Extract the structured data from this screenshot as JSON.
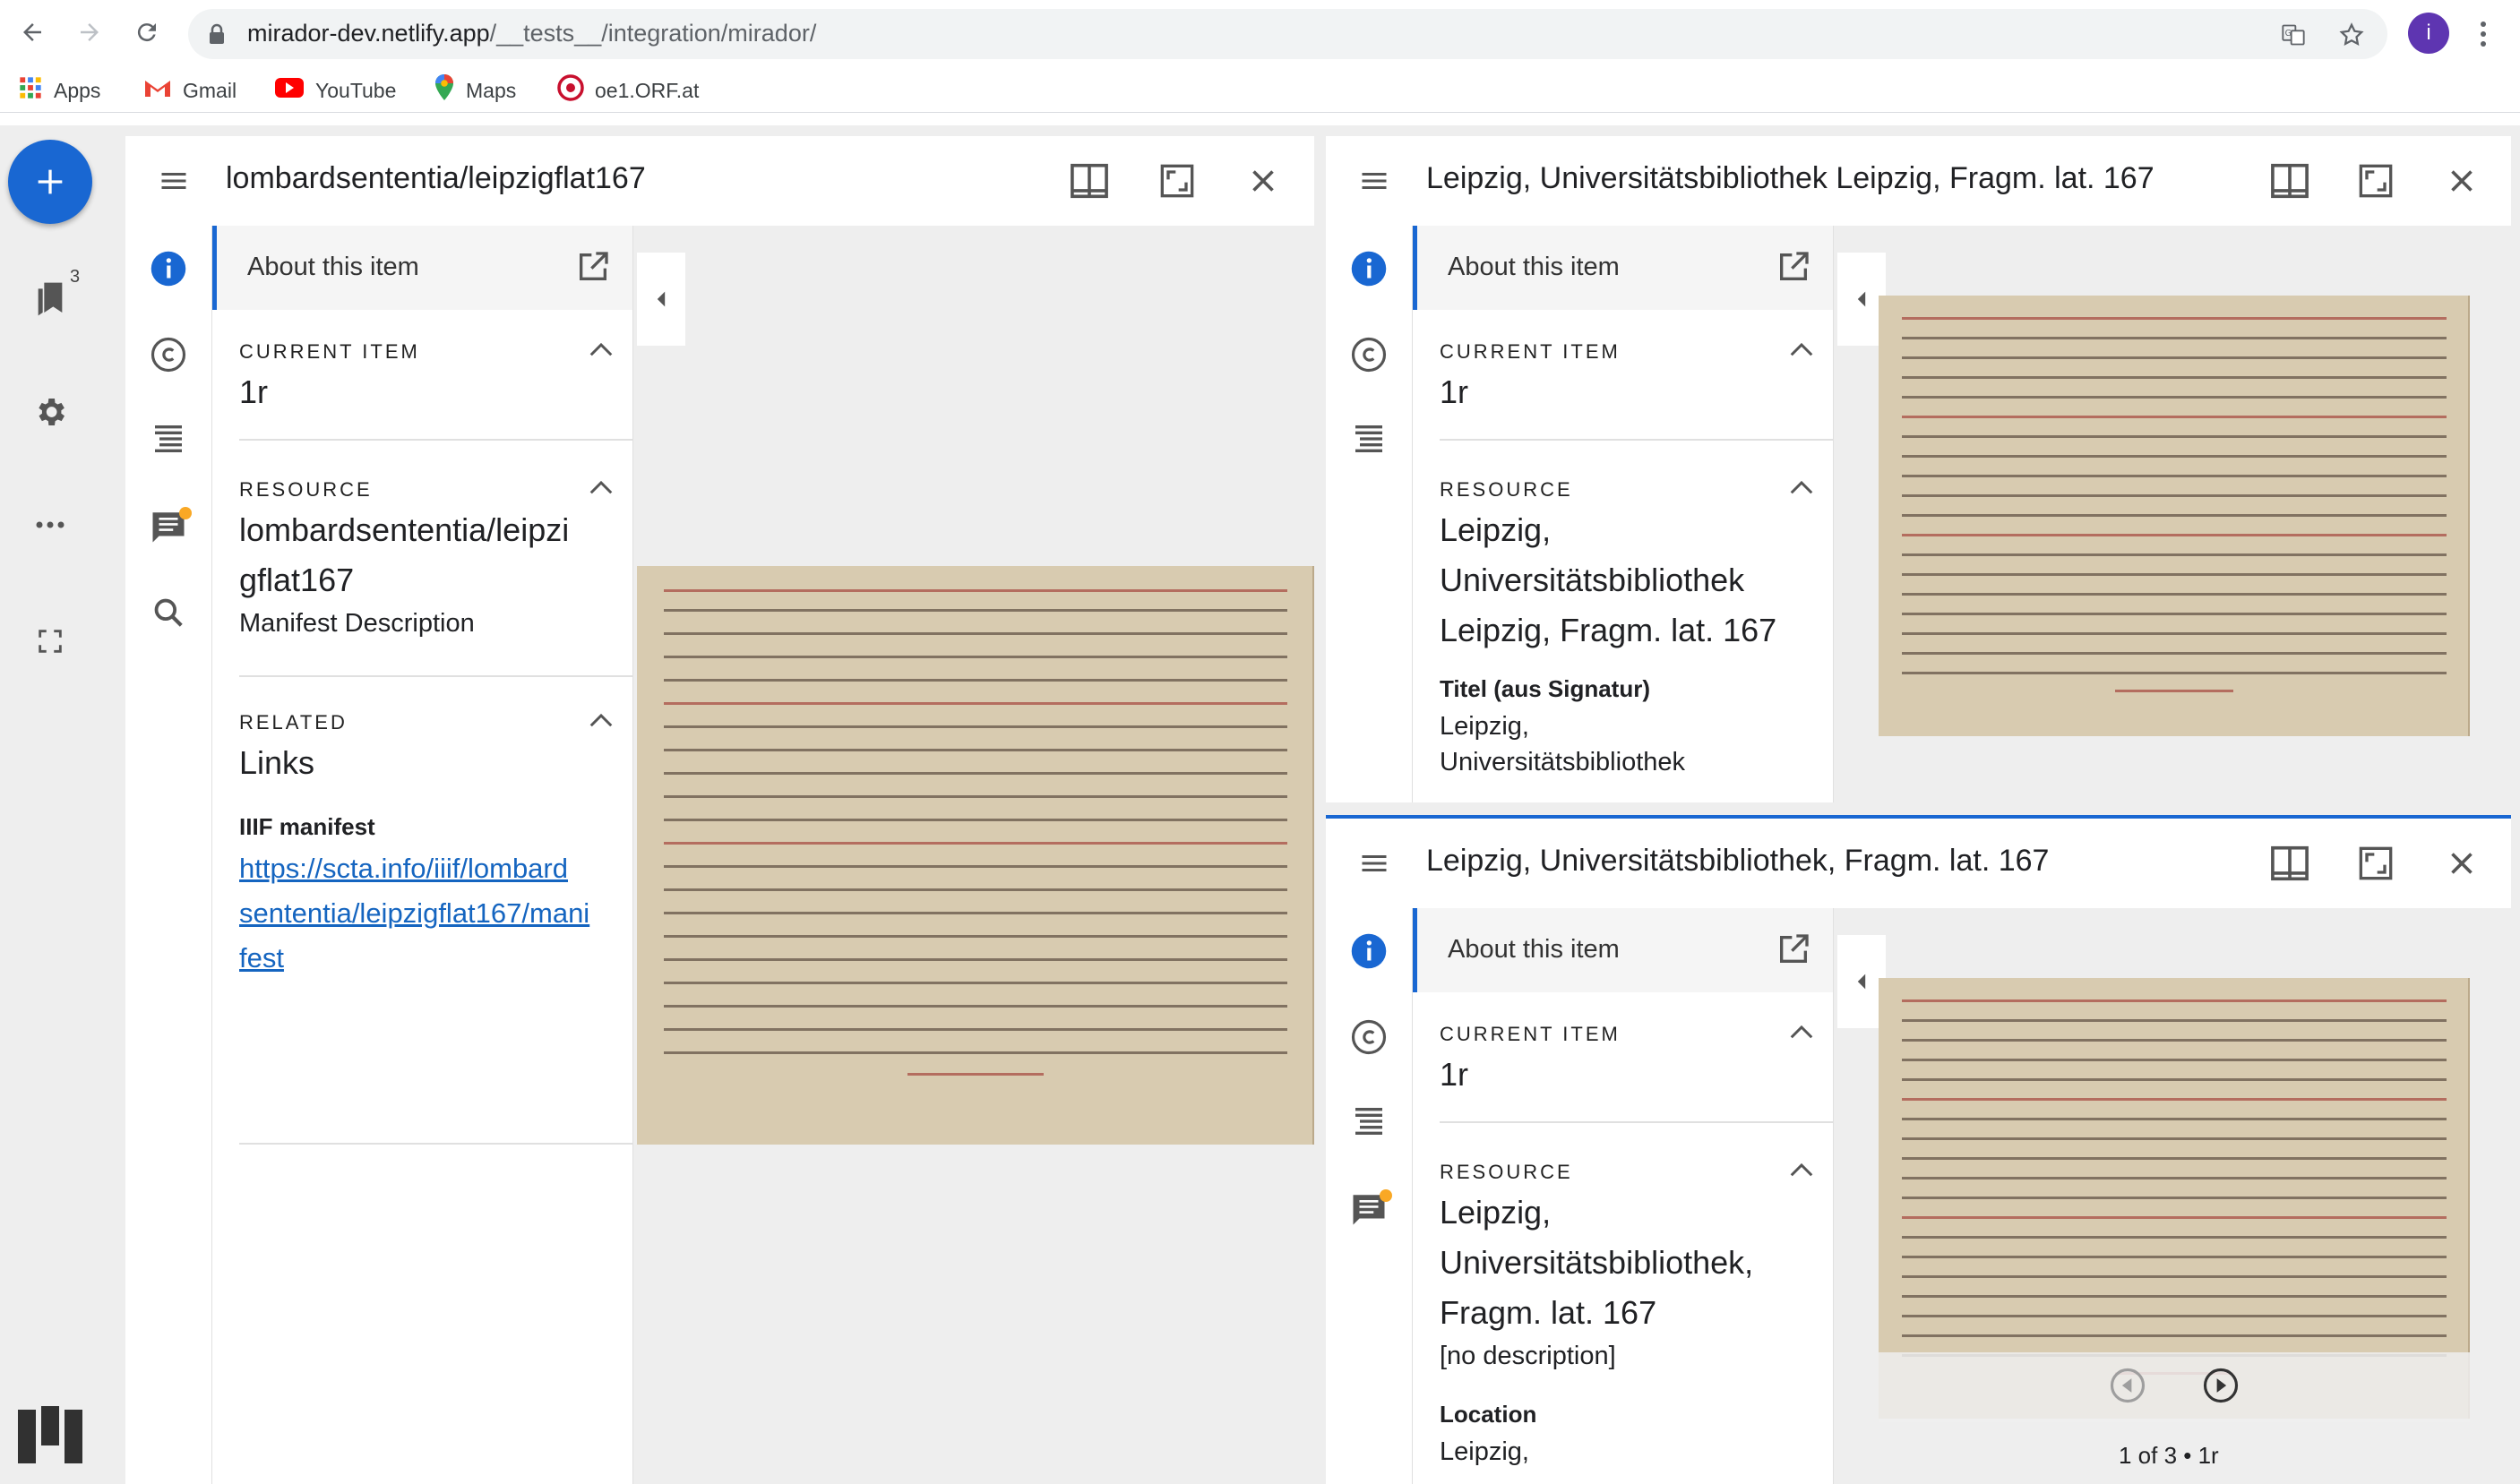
{
  "browser": {
    "url_host": "mirador-dev.netlify.app",
    "url_path": "/__tests__/integration/mirador/",
    "profile_initial": "i"
  },
  "bookmarks": [
    {
      "label": "Apps",
      "icon": "apps-grid-icon"
    },
    {
      "label": "Gmail",
      "icon": "gmail-icon"
    },
    {
      "label": "YouTube",
      "icon": "youtube-icon"
    },
    {
      "label": "Maps",
      "icon": "maps-pin-icon"
    },
    {
      "label": "oe1.ORF.at",
      "icon": "orf-icon"
    }
  ],
  "mirador_sidebar": {
    "catalog_badge": "3"
  },
  "colors": {
    "accent": "#1967d2",
    "notification": "#f9a825",
    "link": "#1565c0"
  },
  "windows": {
    "left": {
      "title": "lombardsententia/leipzigflat167",
      "panel_title": "About this item",
      "current_item_label": "CURRENT ITEM",
      "current_item_value": "1r",
      "resource_label": "RESOURCE",
      "resource_line1": "lombardsententia/leipzi",
      "resource_line2": "gflat167",
      "resource_description": "Manifest Description",
      "related_label": "RELATED",
      "related_value": "Links",
      "iiif_label": "IIIF manifest",
      "iiif_link": "https://scta.info/iiif/lombardsententia/leipzigflat167/manifest",
      "iiif_link_lines": [
        "https://scta.info/iiif/lombard",
        "sententia/leipzigflat167/mani",
        "fest"
      ]
    },
    "top_right": {
      "title": "Leipzig, Universitätsbibliothek Leipzig, Fragm. lat. 167",
      "panel_title": "About this item",
      "current_item_label": "CURRENT ITEM",
      "current_item_value": "1r",
      "resource_label": "RESOURCE",
      "resource_lines": [
        "Leipzig,",
        "Universitätsbibliothek",
        "Leipzig, Fragm. lat. 167"
      ],
      "meta_label": "Titel (aus Signatur)",
      "meta_value": "Leipzig,",
      "meta_value_cut": "Universitätsbibliothek"
    },
    "bottom_right": {
      "title": "Leipzig, Universitätsbibliothek, Fragm. lat. 167",
      "panel_title": "About this item",
      "current_item_label": "CURRENT ITEM",
      "current_item_value": "1r",
      "resource_label": "RESOURCE",
      "resource_lines": [
        "Leipzig,",
        "Universitätsbibliothek,",
        "Fragm. lat. 167"
      ],
      "resource_description": "[no description]",
      "location_label": "Location",
      "location_value_cut": "Leipzig,",
      "page_indicator": "1 of 3 • 1r"
    }
  }
}
